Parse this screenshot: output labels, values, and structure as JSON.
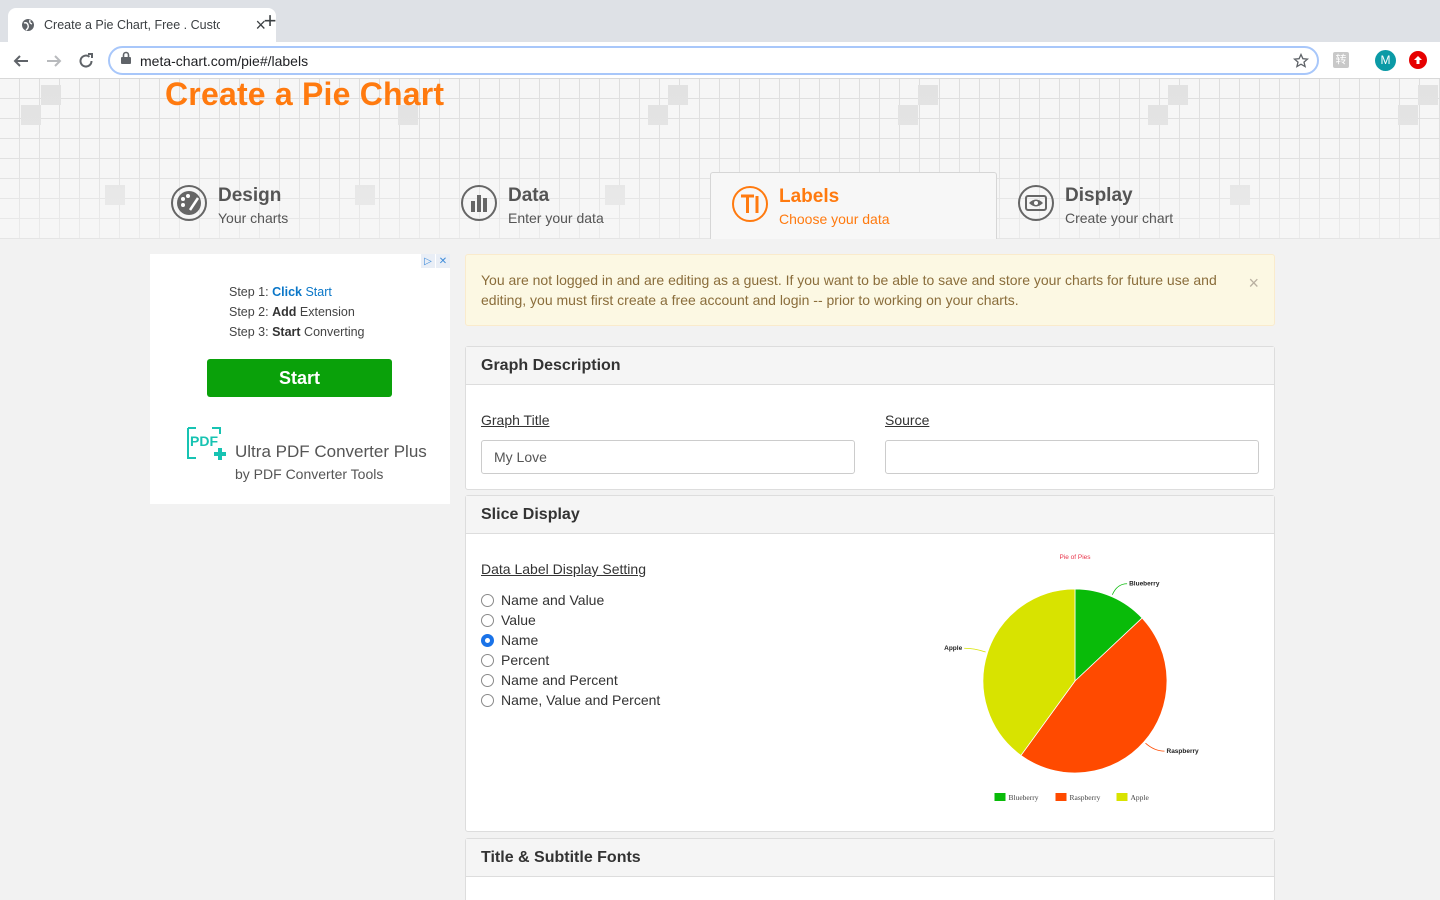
{
  "browser": {
    "tab_title": "Create a Pie Chart, Free . Custom",
    "url": "meta-chart.com/pie#/labels",
    "profile_initial": "M",
    "ext_label": "转"
  },
  "site": {
    "title": "Create a Pie Chart"
  },
  "steps": [
    {
      "name": "Design",
      "sub": "Your charts",
      "icon": "palette-icon"
    },
    {
      "name": "Data",
      "sub": "Enter your data",
      "icon": "bar-chart-icon"
    },
    {
      "name": "Labels",
      "sub": "Choose your data",
      "icon": "text-icon",
      "active": true
    },
    {
      "name": "Display",
      "sub": "Create your chart",
      "icon": "display-icon"
    }
  ],
  "ad": {
    "step1_prefix": "Step 1: ",
    "step1_bold": "Click",
    "step1_rest": " Start",
    "step2_prefix": "Step 2: ",
    "step2_bold": "Add",
    "step2_rest": " Extension",
    "step3_prefix": "Step 3: ",
    "step3_bold": "Start",
    "step3_rest": " Converting",
    "button": "Start",
    "product": "Ultra PDF Converter Plus",
    "byline": "by PDF Converter Tools",
    "logo_text": "PDF"
  },
  "alert": {
    "text": "You are not logged in and are editing as a guest. If you want to be able to save and store your charts for future use and editing, you must first create a free account and login -- prior to working on your charts.",
    "close": "×"
  },
  "graph_description": {
    "heading": "Graph Description",
    "title_label": "Graph Title",
    "title_value": "My Love",
    "source_label": "Source",
    "source_value": ""
  },
  "slice_display": {
    "heading": "Slice Display",
    "setting_label": "Data Label Display Setting",
    "options": [
      "Name and Value",
      "Value",
      "Name",
      "Percent",
      "Name and Percent",
      "Name, Value and Percent"
    ],
    "selected": "Name"
  },
  "fonts_panel": {
    "heading": "Title & Subtitle Fonts"
  },
  "chart_data": {
    "type": "pie",
    "title": "Pie of Pies",
    "series": [
      {
        "name": "Blueberry",
        "value": 13,
        "color": "#09bb09"
      },
      {
        "name": "Raspberry",
        "value": 47,
        "color": "#ff4a00"
      },
      {
        "name": "Apple",
        "value": 40,
        "color": "#d8e300"
      }
    ],
    "legend_position": "bottom"
  }
}
